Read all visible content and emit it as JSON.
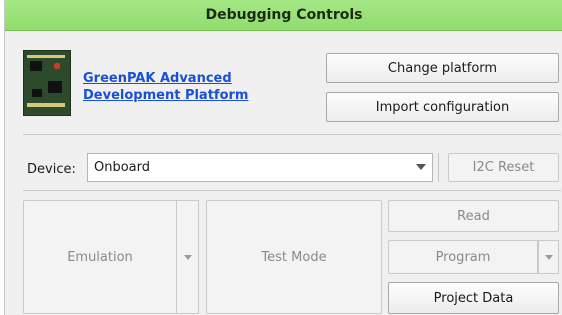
{
  "panel": {
    "title": "Debugging Controls"
  },
  "platform": {
    "image_name": "greenpak-board-image",
    "link_line1": "GreenPAK Advanced",
    "link_line2": "Development Platform",
    "change_platform_label": "Change platform",
    "import_configuration_label": "Import configuration"
  },
  "device": {
    "label": "Device:",
    "selected": "Onboard",
    "i2c_reset_label": "I2C Reset"
  },
  "controls": {
    "emulation_label": "Emulation",
    "test_mode_label": "Test Mode",
    "read_label": "Read",
    "program_label": "Program",
    "project_data_label": "Project Data"
  },
  "colors": {
    "header_green": "#8fdc6d",
    "link_blue": "#1a4fd8"
  }
}
